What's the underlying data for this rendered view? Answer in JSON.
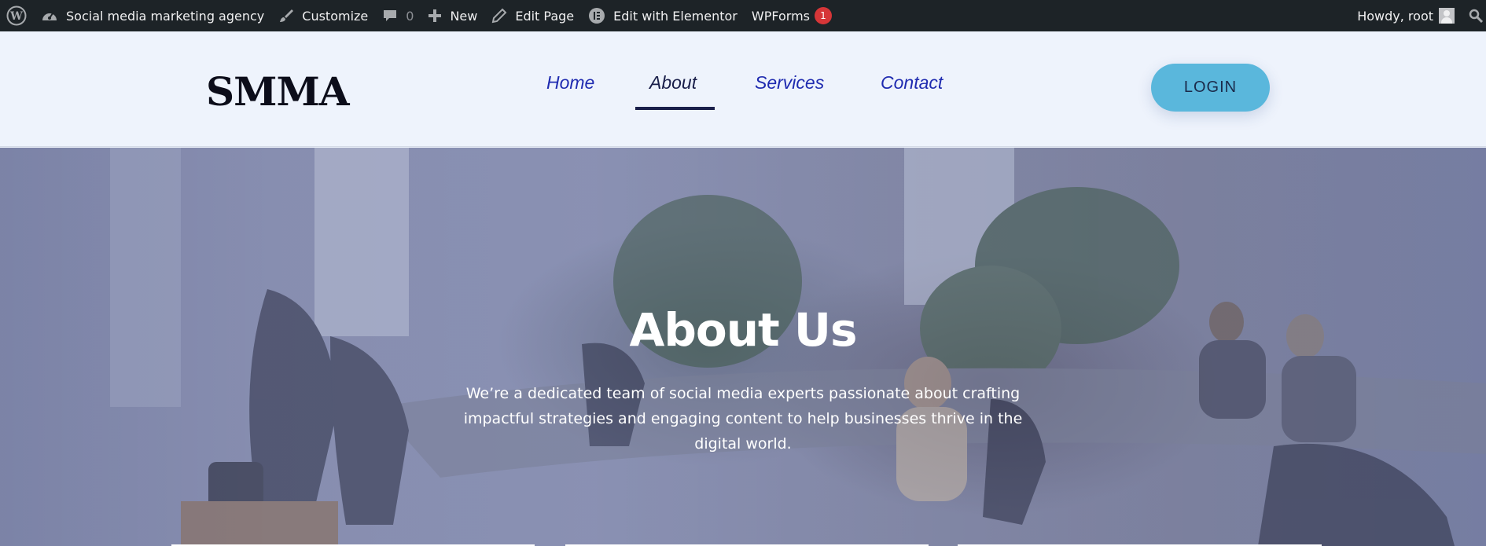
{
  "admin_bar": {
    "site_name": "Social media marketing agency",
    "customize": "Customize",
    "comments_count": "0",
    "new": "New",
    "edit_page": "Edit Page",
    "edit_elementor": "Edit with Elementor",
    "wpforms": "WPForms",
    "wpforms_badge": "1",
    "howdy": "Howdy, root"
  },
  "header": {
    "logo": "SMMA",
    "nav": [
      "Home",
      "About",
      "Services",
      "Contact"
    ],
    "active_nav": "About",
    "login": "LOGIN"
  },
  "hero": {
    "title": "About Us",
    "text": "We’re a dedicated team of social media experts passionate about crafting impactful strategies and engaging content to help businesses thrive in the digital world."
  },
  "colors": {
    "admin_bar": "#1d2327",
    "header_bg": "#eef3fc",
    "nav_link": "#1f2bb0",
    "nav_active": "#1a1f4a",
    "login_button": "#5ab7dc",
    "hero_overlay": "#4c568c",
    "badge": "#d63638"
  }
}
